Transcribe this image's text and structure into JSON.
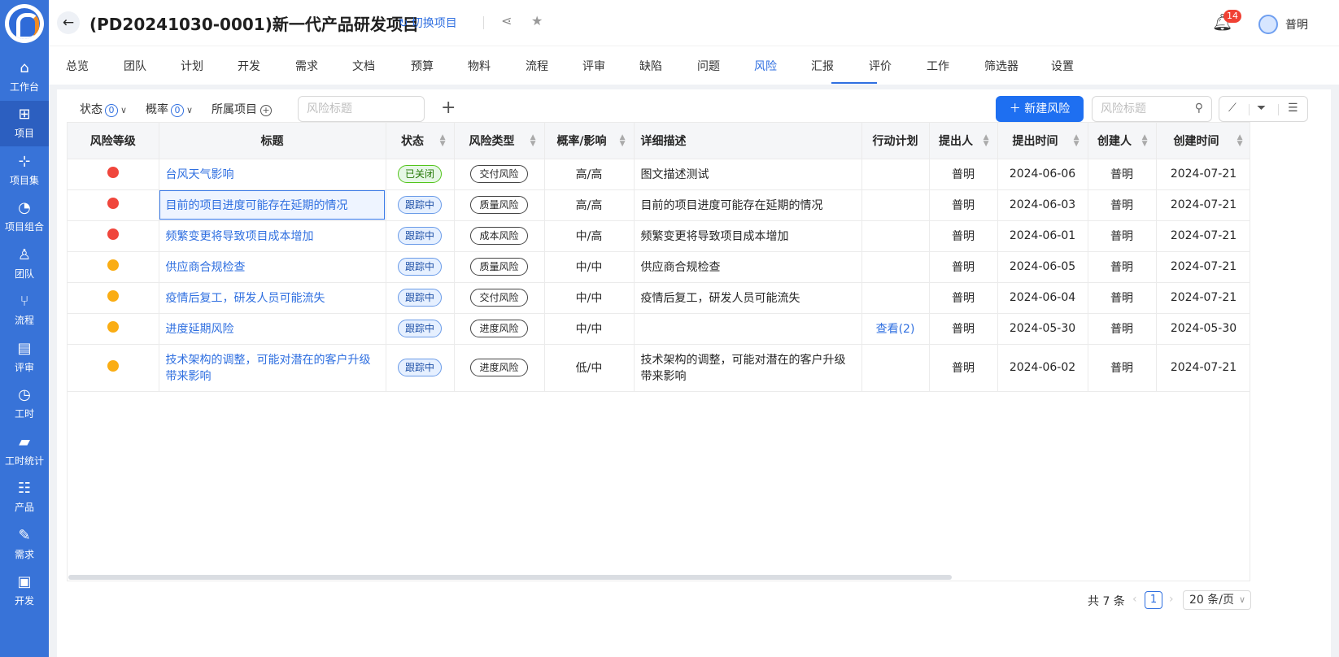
{
  "sidebar": {
    "items": [
      {
        "label": "工作台",
        "icon": "home-icon"
      },
      {
        "label": "项目",
        "icon": "project-board-icon"
      },
      {
        "label": "项目集",
        "icon": "hierarchy-icon"
      },
      {
        "label": "项目组合",
        "icon": "gauge-icon"
      },
      {
        "label": "团队",
        "icon": "team-icon"
      },
      {
        "label": "流程",
        "icon": "flow-icon"
      },
      {
        "label": "评审",
        "icon": "review-icon"
      },
      {
        "label": "工时",
        "icon": "clock-icon"
      },
      {
        "label": "工时统计",
        "icon": "area-chart-icon"
      },
      {
        "label": "产品",
        "icon": "product-grid-icon"
      },
      {
        "label": "需求",
        "icon": "edit-doc-icon"
      },
      {
        "label": "开发",
        "icon": "terminal-icon"
      }
    ],
    "active_index": 1
  },
  "header": {
    "project_title": "(PD20241030-0001)新一代产品研发项目",
    "switch_label": "切换项目",
    "notification_count": "14",
    "user_name": "普明"
  },
  "tabs": [
    "总览",
    "团队",
    "计划",
    "开发",
    "需求",
    "文档",
    "预算",
    "物料",
    "流程",
    "评审",
    "缺陷",
    "问题",
    "风险",
    "汇报",
    "评价",
    "工作",
    "筛选器",
    "设置"
  ],
  "active_tab": "风险",
  "filters": {
    "status_label": "状态",
    "status_count": "0",
    "probability_label": "概率",
    "probability_count": "0",
    "project_label": "所属项目",
    "title_placeholder": "风险标题"
  },
  "toolbar": {
    "new_button": "新建风险",
    "search_placeholder": "风险标题"
  },
  "table": {
    "columns": [
      "风险等级",
      "标题",
      "状态",
      "风险类型",
      "概率/影响",
      "详细描述",
      "行动计划",
      "提出人",
      "提出时间",
      "创建人",
      "创建时间"
    ],
    "rows": [
      {
        "level_color": "#f0463c",
        "title": "台风天气影响",
        "status": "已关闭",
        "status_kind": "closed",
        "type": "交付风险",
        "prob": "高/高",
        "desc": "图文描述测试",
        "plan": "",
        "proposer": "普明",
        "proposed": "2024-06-06",
        "creator": "普明",
        "created": "2024-07-21"
      },
      {
        "level_color": "#f0463c",
        "title": "目前的项目进度可能存在延期的情况",
        "status": "跟踪中",
        "status_kind": "track",
        "type": "质量风险",
        "prob": "高/高",
        "desc": "目前的项目进度可能存在延期的情况",
        "plan": "",
        "proposer": "普明",
        "proposed": "2024-06-03",
        "creator": "普明",
        "created": "2024-07-21"
      },
      {
        "level_color": "#f0463c",
        "title": "频繁变更将导致项目成本增加",
        "status": "跟踪中",
        "status_kind": "track",
        "type": "成本风险",
        "prob": "中/高",
        "desc": "频繁变更将导致项目成本增加",
        "plan": "",
        "proposer": "普明",
        "proposed": "2024-06-01",
        "creator": "普明",
        "created": "2024-07-21"
      },
      {
        "level_color": "#faad14",
        "title": "供应商合规检查",
        "status": "跟踪中",
        "status_kind": "track",
        "type": "质量风险",
        "prob": "中/中",
        "desc": "供应商合规检查",
        "plan": "",
        "proposer": "普明",
        "proposed": "2024-06-05",
        "creator": "普明",
        "created": "2024-07-21"
      },
      {
        "level_color": "#faad14",
        "title": "疫情后复工，研发人员可能流失",
        "status": "跟踪中",
        "status_kind": "track",
        "type": "交付风险",
        "prob": "中/中",
        "desc": "疫情后复工，研发人员可能流失",
        "plan": "",
        "proposer": "普明",
        "proposed": "2024-06-04",
        "creator": "普明",
        "created": "2024-07-21"
      },
      {
        "level_color": "#faad14",
        "title": "进度延期风险",
        "status": "跟踪中",
        "status_kind": "track",
        "type": "进度风险",
        "prob": "中/中",
        "desc": "",
        "plan": "查看(2)",
        "proposer": "普明",
        "proposed": "2024-05-30",
        "creator": "普明",
        "created": "2024-05-30"
      },
      {
        "level_color": "#faad14",
        "title": "技术架构的调整，可能对潜在的客户升级带来影响",
        "status": "跟踪中",
        "status_kind": "track",
        "type": "进度风险",
        "prob": "低/中",
        "desc": "技术架构的调整，可能对潜在的客户升级带来影响",
        "plan": "",
        "proposer": "普明",
        "proposed": "2024-06-02",
        "creator": "普明",
        "created": "2024-07-21"
      }
    ]
  },
  "pager": {
    "total": "共 7 条",
    "page": "1",
    "page_size": "20 条/页"
  },
  "colors": {
    "sidebar": "#3873d8",
    "accent": "#2f6fe0",
    "high_risk": "#f0463c",
    "medium_risk": "#faad14"
  }
}
